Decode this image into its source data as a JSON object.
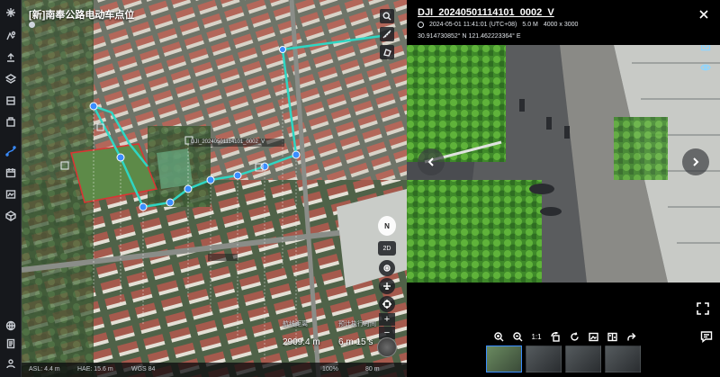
{
  "map": {
    "title": "[新]南奉公路电动车点位",
    "subtitle": "",
    "photo_label": "DJI_20240501114101_0002_V",
    "distance_label": "航线距离",
    "distance_value": "2909.4 m",
    "time_label": "预计执行时间",
    "time_value": "6 m 15 s",
    "compass_label": "N",
    "mode_2d": "2D",
    "zoom_in": "+",
    "zoom_out": "−",
    "status": {
      "asl": "ASL: 4.4 m",
      "hae": "HAE: 15.6 m",
      "crs": "WGS 84",
      "zoom_pct": "100%",
      "scale": "80 m"
    }
  },
  "viewer": {
    "title": "DJI_20240501114101_0002_V",
    "datetime": "2024-05-01 11:41:01 (UTC+08)",
    "size": "5.0 M",
    "resolution": "4000 x 3000",
    "coords": "30.914730852° N   121.462223364° E",
    "ratio_label": "1:1"
  },
  "icons": {
    "sidebar": [
      "logo-icon",
      "route-icon",
      "upload-icon",
      "layer-icon",
      "device-icon",
      "calendar-icon",
      "media-icon",
      "settings-icon"
    ],
    "accent": "#3a8dff",
    "route_color": "#2fd6c3"
  }
}
